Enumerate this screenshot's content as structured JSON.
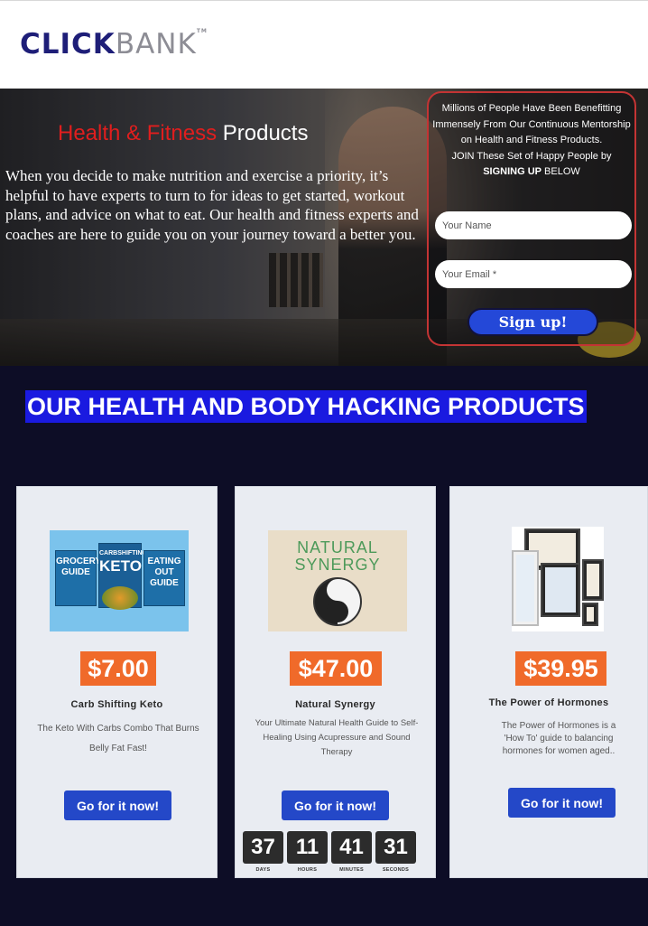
{
  "brand": {
    "logo_primary": "CLICK",
    "logo_secondary": "BANK",
    "logo_tm": "TM",
    "primary_color": "#1e1e78",
    "secondary_color": "#8d8d95"
  },
  "hero": {
    "title_red": "Health & Fitness",
    "title_white": " Products",
    "description": "When you decide to make nutrition and exercise a priority, it’s helpful to have experts to turn to for ideas to get started, workout plans, and advice on what to eat. Our health and fitness experts and coaches are here to guide you on your journey toward a better you."
  },
  "signup": {
    "intro": "Millions of People Have Been Benefitting Immensely From Our Continuous Mentorship on Health and Fitness Products.",
    "join_prefix": "JOIN These Set of Happy People by ",
    "join_bold": "SIGNING UP",
    "join_suffix": " BELOW",
    "name_placeholder": "Your Name",
    "email_placeholder": "Your Email *",
    "button_label": "Sign up!",
    "button_color": "#2448d8",
    "border_color": "#c33434"
  },
  "products_section": {
    "heading": "OUR HEALTH AND BODY HACKING PRODUCTS",
    "heading_bg": "#1a1ae0",
    "items": [
      {
        "price": "$7.00",
        "name": "Carb Shifting Keto",
        "description": "The Keto With Carbs Combo That Burns Belly Fat Fast!",
        "button": "Go for it now!",
        "image_books": [
          "GROCERY GUIDE",
          "KETO",
          "EATING OUT GUIDE"
        ],
        "image_book_header": "CARBSHIFTING"
      },
      {
        "price": "$47.00",
        "name": "Natural Synergy",
        "description": "Your Ultimate Natural Health Guide to Self-Healing Using Acupressure and Sound Therapy",
        "button": "Go for it now!",
        "image_title": "NATURAL SYNERGY"
      },
      {
        "price": "$39.95",
        "name": "The Power of Hormones",
        "description": "The Power of Hormones is a 'How To' guide to balancing hormones for women aged..",
        "button": "Go for it now!"
      }
    ],
    "price_color": "#f06a2a",
    "button_color": "#2448c8"
  },
  "countdown": {
    "units": [
      {
        "value": "37",
        "label": "DAYS"
      },
      {
        "value": "11",
        "label": "HOURS"
      },
      {
        "value": "41",
        "label": "MINUTES"
      },
      {
        "value": "31",
        "label": "SECONDS"
      }
    ]
  }
}
